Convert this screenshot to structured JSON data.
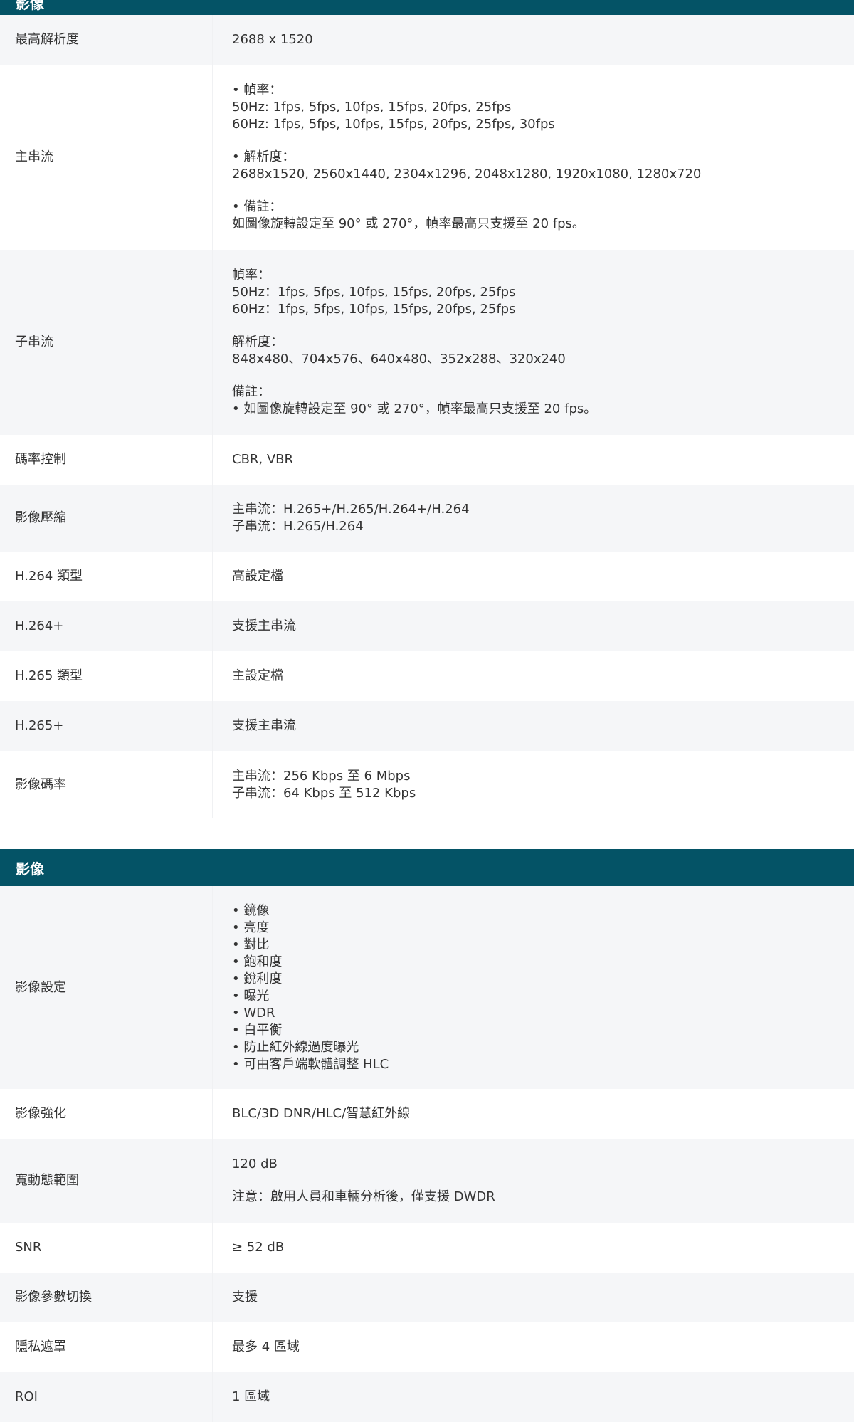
{
  "sections": [
    {
      "header": "影像",
      "rows": [
        {
          "label": "最高解析度",
          "lines": [
            "2688 x 1520"
          ]
        },
        {
          "label": "主串流",
          "lines": [
            "• 幀率：",
            "50Hz: 1fps, 5fps, 10fps, 15fps, 20fps, 25fps",
            "60Hz: 1fps, 5fps, 10fps, 15fps, 20fps, 25fps, 30fps",
            "",
            "• 解析度：",
            "2688x1520, 2560x1440, 2304x1296, 2048x1280, 1920x1080, 1280x720",
            "",
            "• 備註：",
            "如圖像旋轉設定至 90° 或 270°，幀率最高只支援至 20 fps。"
          ]
        },
        {
          "label": "子串流",
          "lines": [
            "幀率：",
            "50Hz：1fps, 5fps, 10fps, 15fps, 20fps, 25fps",
            "60Hz：1fps, 5fps, 10fps, 15fps, 20fps, 25fps",
            "",
            "解析度：",
            "848x480、704x576、640x480、352x288、320x240",
            "",
            "備註：",
            "• 如圖像旋轉設定至 90° 或 270°，幀率最高只支援至 20 fps。"
          ]
        },
        {
          "label": "碼率控制",
          "lines": [
            "CBR, VBR"
          ]
        },
        {
          "label": "影像壓縮",
          "lines": [
            "主串流：H.265+/H.265/H.264+/H.264",
            "子串流：H.265/H.264"
          ]
        },
        {
          "label": "H.264 類型",
          "lines": [
            "高設定檔"
          ]
        },
        {
          "label": "H.264+",
          "lines": [
            "支援主串流"
          ]
        },
        {
          "label": "H.265 類型",
          "lines": [
            "主設定檔"
          ]
        },
        {
          "label": "H.265+",
          "lines": [
            "支援主串流"
          ]
        },
        {
          "label": "影像碼率",
          "lines": [
            "主串流：256 Kbps 至 6 Mbps",
            "子串流：64 Kbps 至 512 Kbps"
          ]
        }
      ]
    },
    {
      "header": "影像",
      "rows": [
        {
          "label": "影像設定",
          "lines": [
            "• 鏡像",
            "• 亮度",
            "• 對比",
            "• 飽和度",
            "• 銳利度",
            "• 曝光",
            "• WDR",
            "• 白平衡",
            "• 防止紅外線過度曝光",
            "• 可由客戶端軟體調整 HLC"
          ]
        },
        {
          "label": "影像強化",
          "lines": [
            "BLC/3D DNR/HLC/智慧紅外線"
          ]
        },
        {
          "label": "寬動態範圍",
          "lines": [
            "120 dB",
            "",
            "注意：啟用人員和車輛分析後，僅支援 DWDR"
          ]
        },
        {
          "label": "SNR",
          "lines": [
            "≥ 52 dB"
          ]
        },
        {
          "label": "影像參數切換",
          "lines": [
            "支援"
          ]
        },
        {
          "label": "隱私遮罩",
          "lines": [
            "最多 4 區域"
          ]
        },
        {
          "label": "ROI",
          "lines": [
            "1 區域"
          ]
        }
      ]
    }
  ]
}
